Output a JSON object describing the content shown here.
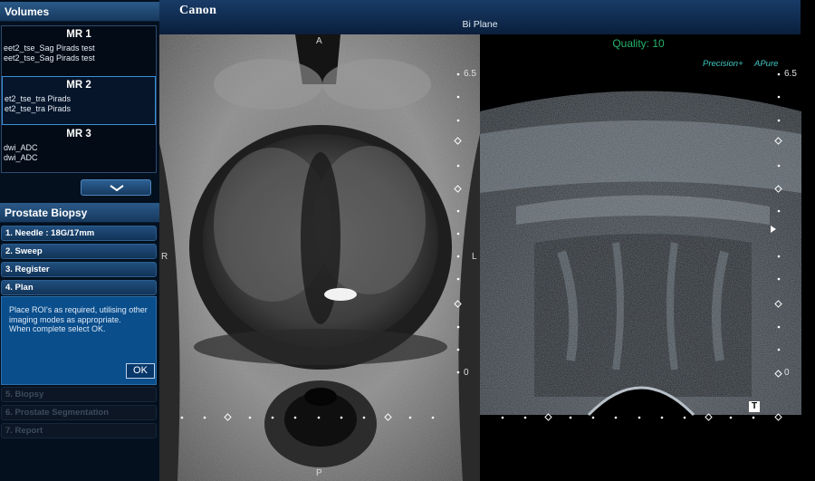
{
  "volumes": {
    "header": "Volumes",
    "items": [
      {
        "title": "MR 1",
        "lines": [
          "eet2_tse_Sag Pirads test",
          "eet2_tse_Sag Pirads test"
        ]
      },
      {
        "title": "MR 2",
        "lines": [
          "et2_tse_tra Pirads",
          "et2_tse_tra Pirads"
        ]
      },
      {
        "title": "MR 3",
        "lines": [
          "dwi_ADC",
          "dwi_ADC"
        ]
      }
    ]
  },
  "biopsy": {
    "header": "Prostate Biopsy",
    "steps": [
      {
        "label": "1. Needle : 18G/17mm"
      },
      {
        "label": "2. Sweep"
      },
      {
        "label": "3. Register"
      },
      {
        "label": "4. Plan"
      },
      {
        "label": "5. Biopsy"
      },
      {
        "label": "6. Prostate Segmentation"
      },
      {
        "label": "7. Report"
      }
    ],
    "instructions": "Place ROI's as required, utilising other imaging modes as appropriate.\nWhen complete select OK.",
    "ok_label": "OK"
  },
  "topbar": {
    "brand": "Canon",
    "title": "Bi Plane"
  },
  "mr_view": {
    "orient_top": "A",
    "orient_left": "R",
    "orient_right": "L",
    "orient_bottom": "P",
    "scale_top": "6.5",
    "scale_bottom": "0"
  },
  "us_view": {
    "quality": "Quality: 10",
    "precision": "Precision+",
    "apure": "APure",
    "scale_top": "6.5",
    "scale_bottom": "0",
    "t_marker": "T"
  }
}
